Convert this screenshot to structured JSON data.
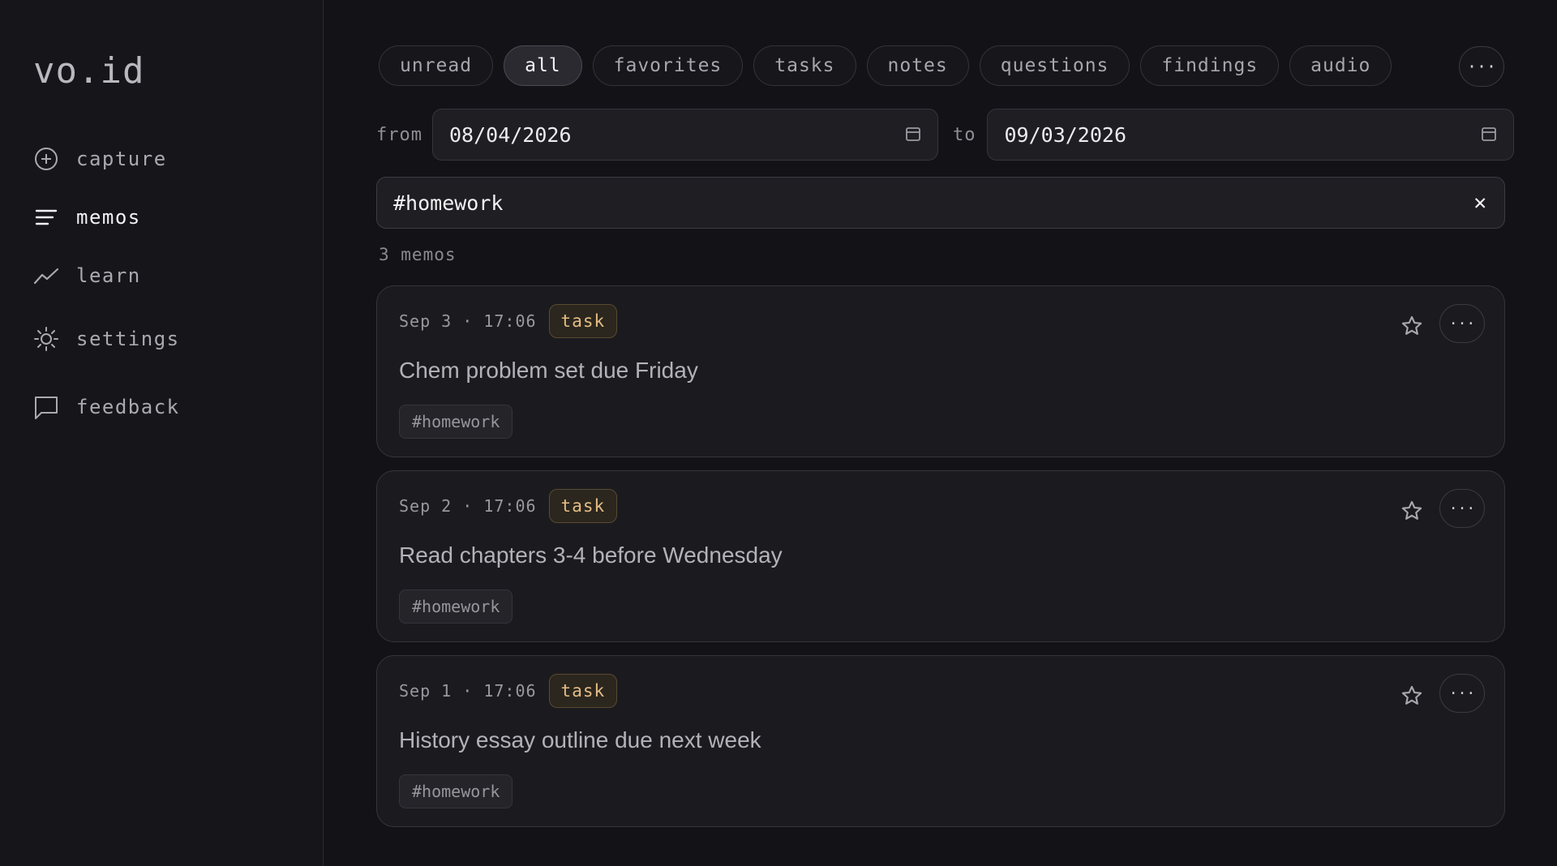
{
  "app": {
    "logo": "vo.id"
  },
  "sidebar": {
    "items": [
      {
        "label": "capture",
        "icon": "plus-circle-icon"
      },
      {
        "label": "memos",
        "icon": "lines-icon",
        "active": true
      },
      {
        "label": "learn",
        "icon": "trend-line-icon"
      },
      {
        "label": "settings",
        "icon": "sun-gear-icon"
      },
      {
        "label": "feedback",
        "icon": "chat-bubble-icon"
      }
    ]
  },
  "filters": {
    "chips": [
      "unread",
      "all",
      "favorites",
      "tasks",
      "notes",
      "questions",
      "findings",
      "audio"
    ],
    "active": "all",
    "more_label": "···"
  },
  "date_range": {
    "from_label": "from",
    "from_value": "08/04/2026",
    "to_label": "to",
    "to_value": "09/03/2026"
  },
  "search": {
    "value": "#homework",
    "clear_label": "✕"
  },
  "count_label": "3 memos",
  "memos": [
    {
      "date": "Sep 3 · 17:06",
      "type": "task",
      "title": "Chem problem set due Friday",
      "tag": "#homework",
      "more_label": "···"
    },
    {
      "date": "Sep 2 · 17:06",
      "type": "task",
      "title": "Read chapters 3-4 before Wednesday",
      "tag": "#homework",
      "more_label": "···"
    },
    {
      "date": "Sep 1 · 17:06",
      "type": "task",
      "title": "History essay outline due next week",
      "tag": "#homework",
      "more_label": "···"
    }
  ],
  "colors": {
    "background": "#131317",
    "sidebar": "#16161a",
    "card": "#1b1b1f",
    "task_badge_text": "#e4bd84",
    "task_badge_border": "#5a4a30"
  }
}
